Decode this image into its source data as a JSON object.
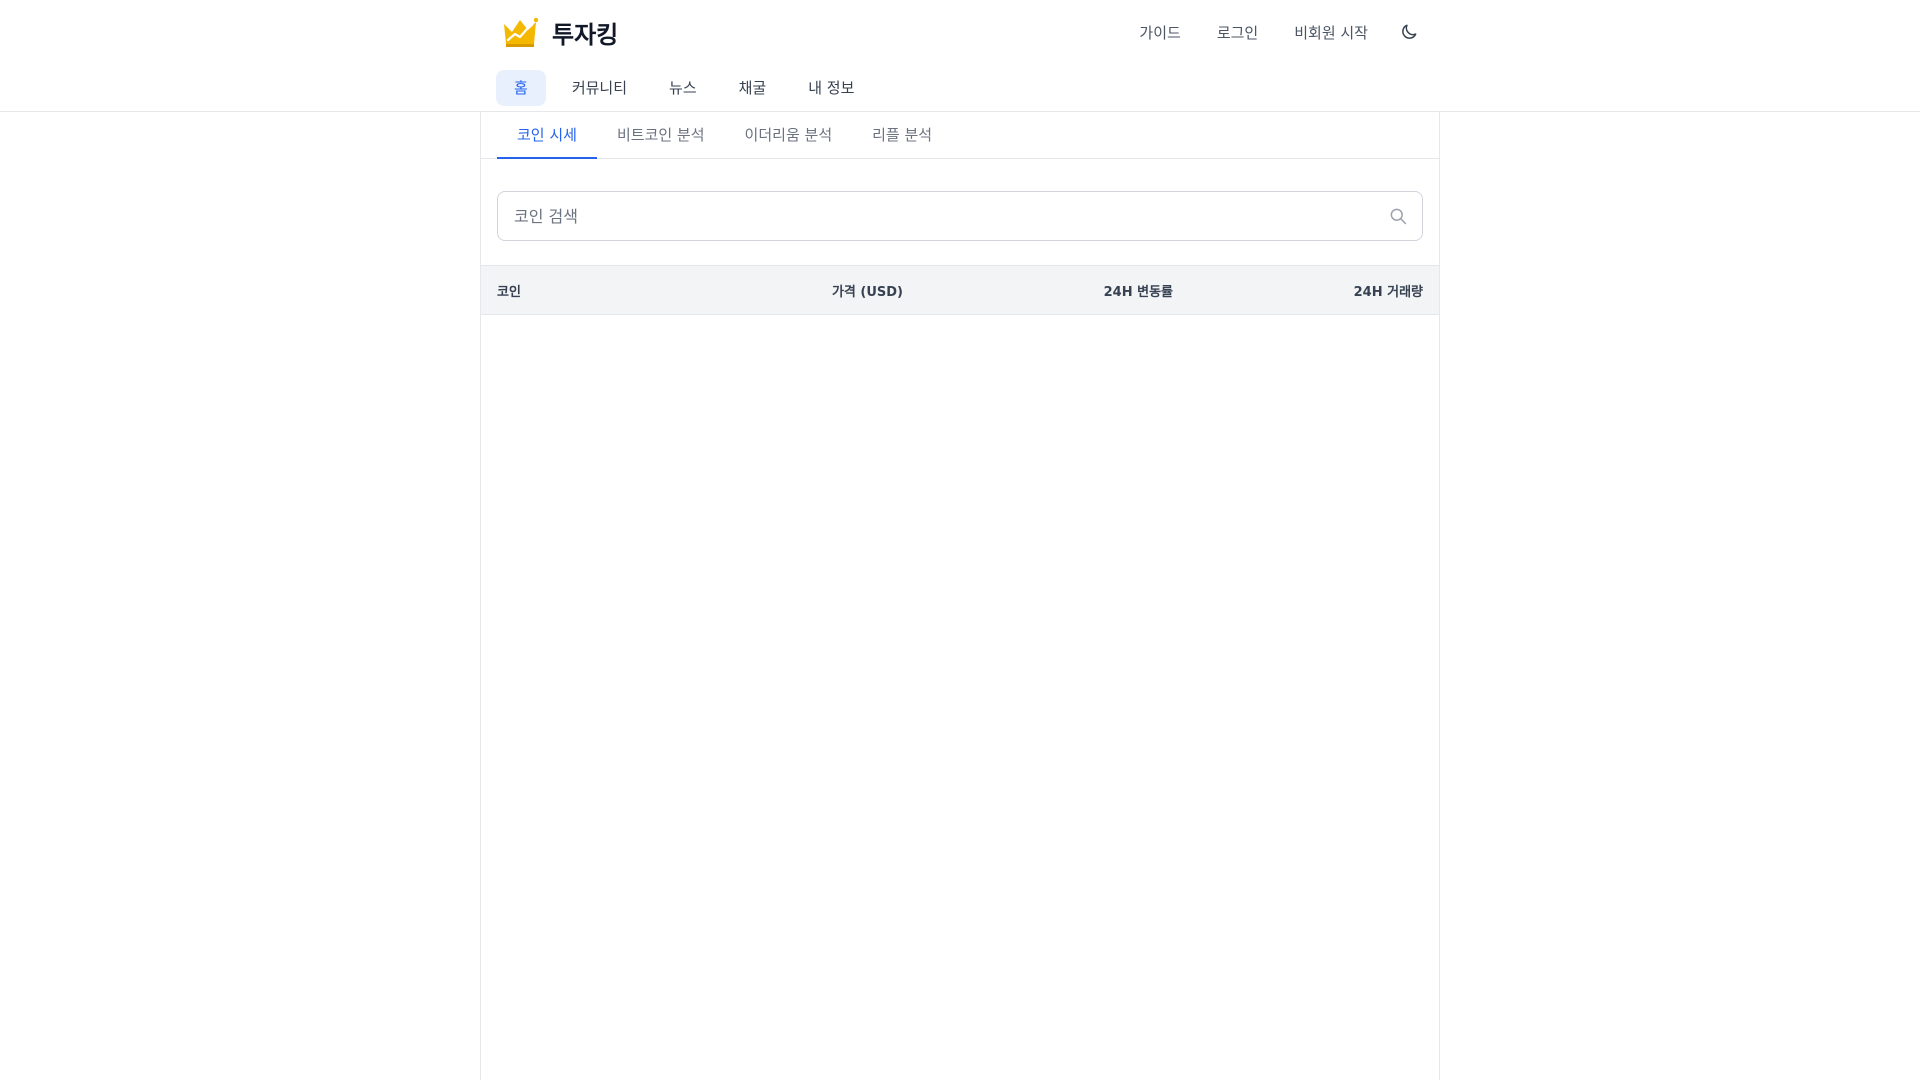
{
  "brand": {
    "name": "투자킹",
    "icon": "crown-chart-icon",
    "colors": {
      "gold": "#f5b800",
      "dark_gold": "#d99a00"
    }
  },
  "header": {
    "links": [
      "가이드",
      "로그인",
      "비회원 시작"
    ],
    "theme_toggle_icon": "moon-icon"
  },
  "main_nav": {
    "items": [
      "홈",
      "커뮤니티",
      "뉴스",
      "채굴",
      "내 정보"
    ],
    "active_index": 0
  },
  "subtabs": {
    "items": [
      "코인 시세",
      "비트코인 분석",
      "이더리움 분석",
      "리플 분석"
    ],
    "active_index": 0
  },
  "search": {
    "placeholder": "코인 검색",
    "value": "",
    "icon": "search-icon"
  },
  "table": {
    "columns": [
      "코인",
      "가격 (USD)",
      "24H 변동률",
      "24H 거래량"
    ],
    "rows": []
  },
  "colors": {
    "accent": "#2563eb",
    "active_nav_bg": "#e8f0fe",
    "table_header_bg": "#f3f4f6",
    "border": "#e5e7eb"
  }
}
